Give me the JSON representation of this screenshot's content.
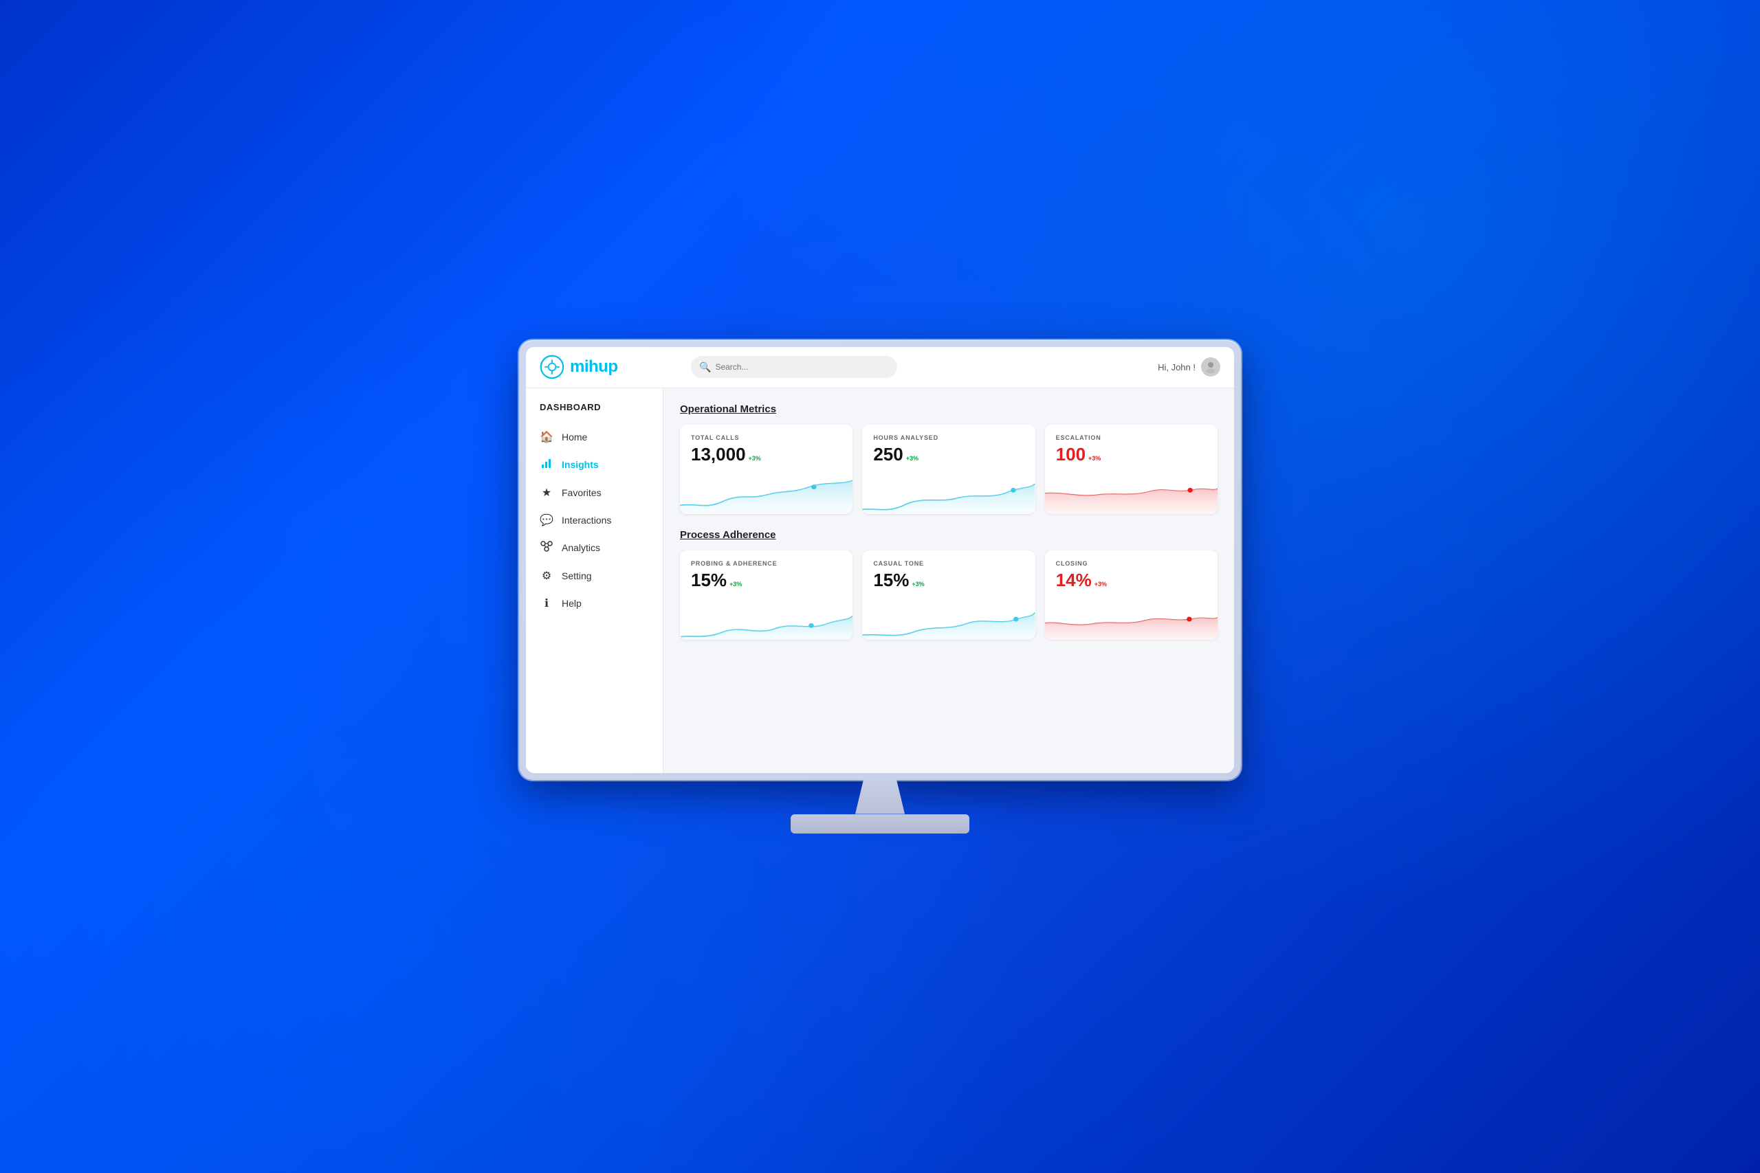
{
  "header": {
    "logo_text": "mihup",
    "search_placeholder": "Search...",
    "user_greeting": "Hi, John !"
  },
  "sidebar": {
    "title": "DASHBOARD",
    "items": [
      {
        "id": "home",
        "label": "Home",
        "icon": "🏠",
        "active": false
      },
      {
        "id": "insights",
        "label": "Insights",
        "icon": "📊",
        "active": true
      },
      {
        "id": "favorites",
        "label": "Favorites",
        "icon": "★",
        "active": false
      },
      {
        "id": "interactions",
        "label": "Interactions",
        "icon": "💬",
        "active": false
      },
      {
        "id": "analytics",
        "label": "Analytics",
        "icon": "⚙",
        "active": false
      },
      {
        "id": "setting",
        "label": "Setting",
        "icon": "⚙",
        "active": false
      },
      {
        "id": "help",
        "label": "Help",
        "icon": "ℹ",
        "active": false
      }
    ]
  },
  "operational_metrics": {
    "section_title": "Operational Metrics",
    "cards": [
      {
        "id": "total-calls",
        "label": "TOTAL CALLS",
        "value": "13,000",
        "badge": "+3%",
        "badge_color": "green",
        "chart_type": "line_blue"
      },
      {
        "id": "hours-analysed",
        "label": "HOURS ANALYSED",
        "value": "250",
        "badge": "+3%",
        "badge_color": "green",
        "chart_type": "line_blue"
      },
      {
        "id": "escalation",
        "label": "ESCALATION",
        "value": "100",
        "badge": "+3%",
        "badge_color": "red",
        "value_color": "red",
        "chart_type": "line_red"
      }
    ]
  },
  "process_adherence": {
    "section_title": "Process Adherence",
    "cards": [
      {
        "id": "probing-adherence",
        "label": "PROBING & ADHERENCE",
        "value": "15%",
        "badge": "+3%",
        "badge_color": "green",
        "chart_type": "line_blue"
      },
      {
        "id": "casual-tone",
        "label": "CASUAL TONE",
        "value": "15%",
        "badge": "+3%",
        "badge_color": "green",
        "chart_type": "line_blue"
      },
      {
        "id": "closing",
        "label": "CLOSING",
        "value": "14%",
        "badge": "+3%",
        "badge_color": "red",
        "value_color": "red",
        "chart_type": "line_red"
      }
    ]
  }
}
